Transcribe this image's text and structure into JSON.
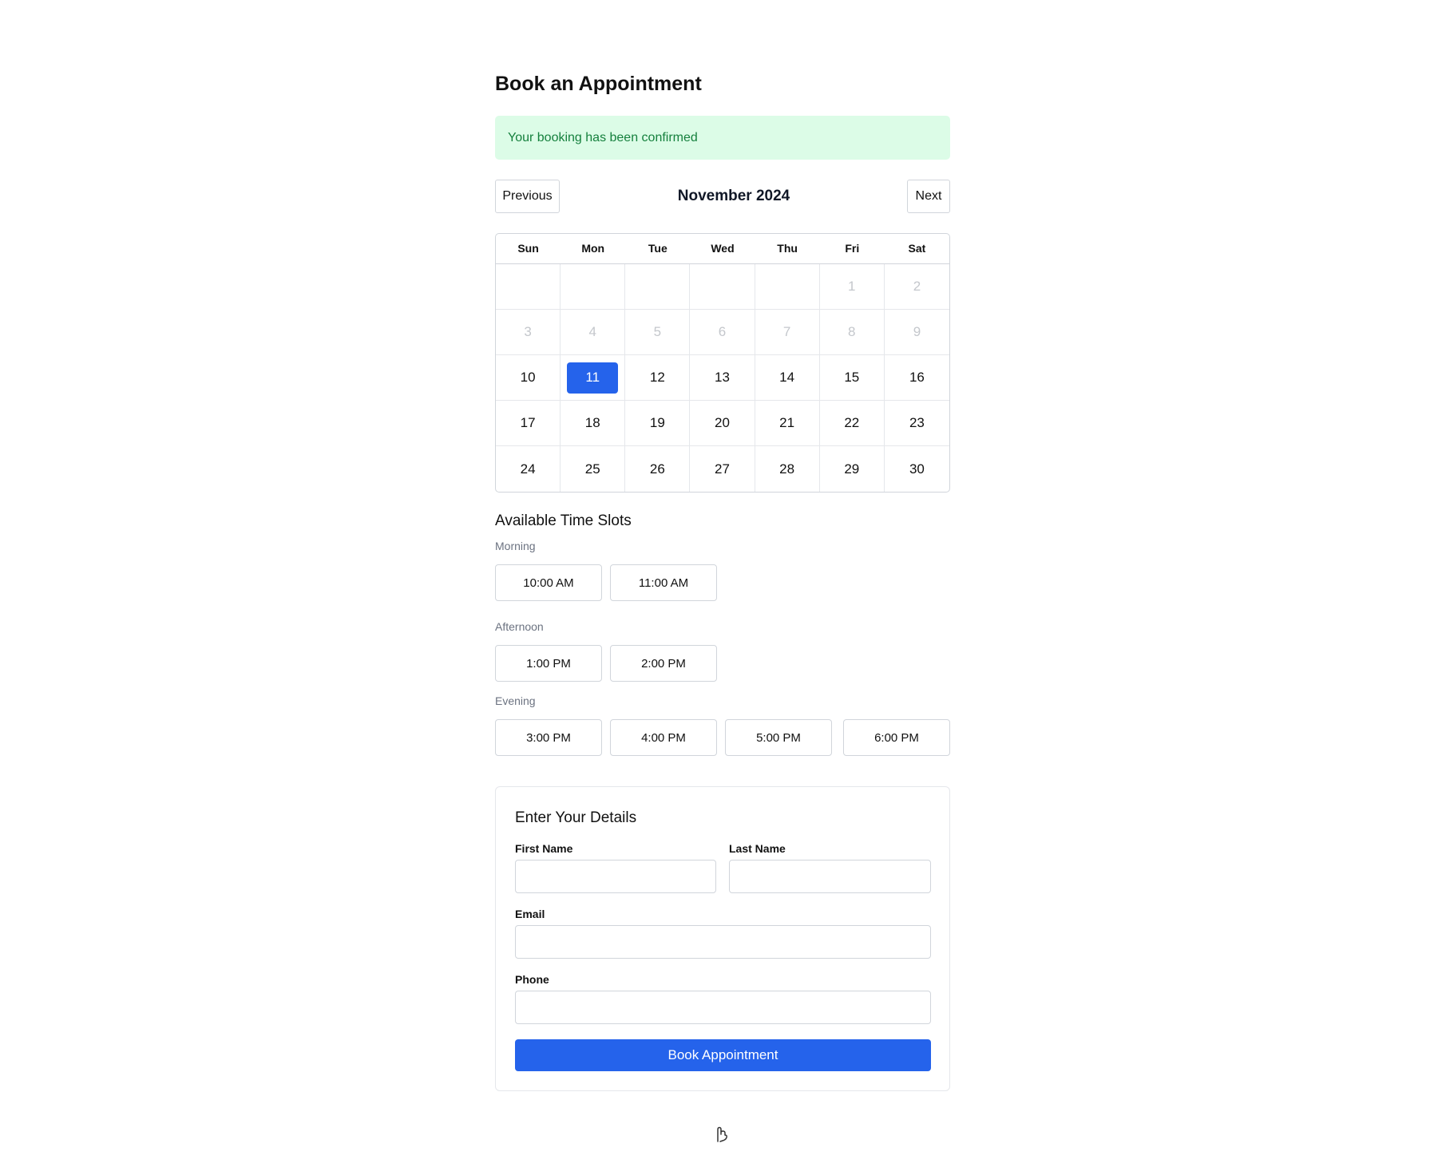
{
  "page": {
    "title": "Book an Appointment",
    "alert": "Your booking has been confirmed"
  },
  "calendar": {
    "prev_label": "Previous",
    "next_label": "Next",
    "month": "November 2024",
    "weekdays": [
      "Sun",
      "Mon",
      "Tue",
      "Wed",
      "Thu",
      "Fri",
      "Sat"
    ],
    "leading_blanks": 5,
    "days_in_month": 30,
    "disabled_through": 9,
    "selected_day": 11,
    "selected_color": "#2563eb"
  },
  "slots": {
    "title": "Available Time Slots",
    "groups": [
      {
        "label": "Morning",
        "times": [
          "10:00 AM",
          "11:00 AM"
        ]
      },
      {
        "label": "Afternoon",
        "times": [
          "1:00 PM",
          "2:00 PM"
        ]
      },
      {
        "label": "Evening",
        "times": [
          "3:00 PM",
          "4:00 PM",
          "5:00 PM",
          "6:00 PM"
        ]
      }
    ]
  },
  "details": {
    "title": "Enter Your Details",
    "first_name_label": "First Name",
    "first_name_value": "",
    "last_name_label": "Last Name",
    "last_name_value": "",
    "email_label": "Email",
    "email_value": "",
    "phone_label": "Phone",
    "phone_value": "",
    "submit_label": "Book Appointment"
  },
  "footer": {
    "icon": "hand-pointer-icon"
  }
}
